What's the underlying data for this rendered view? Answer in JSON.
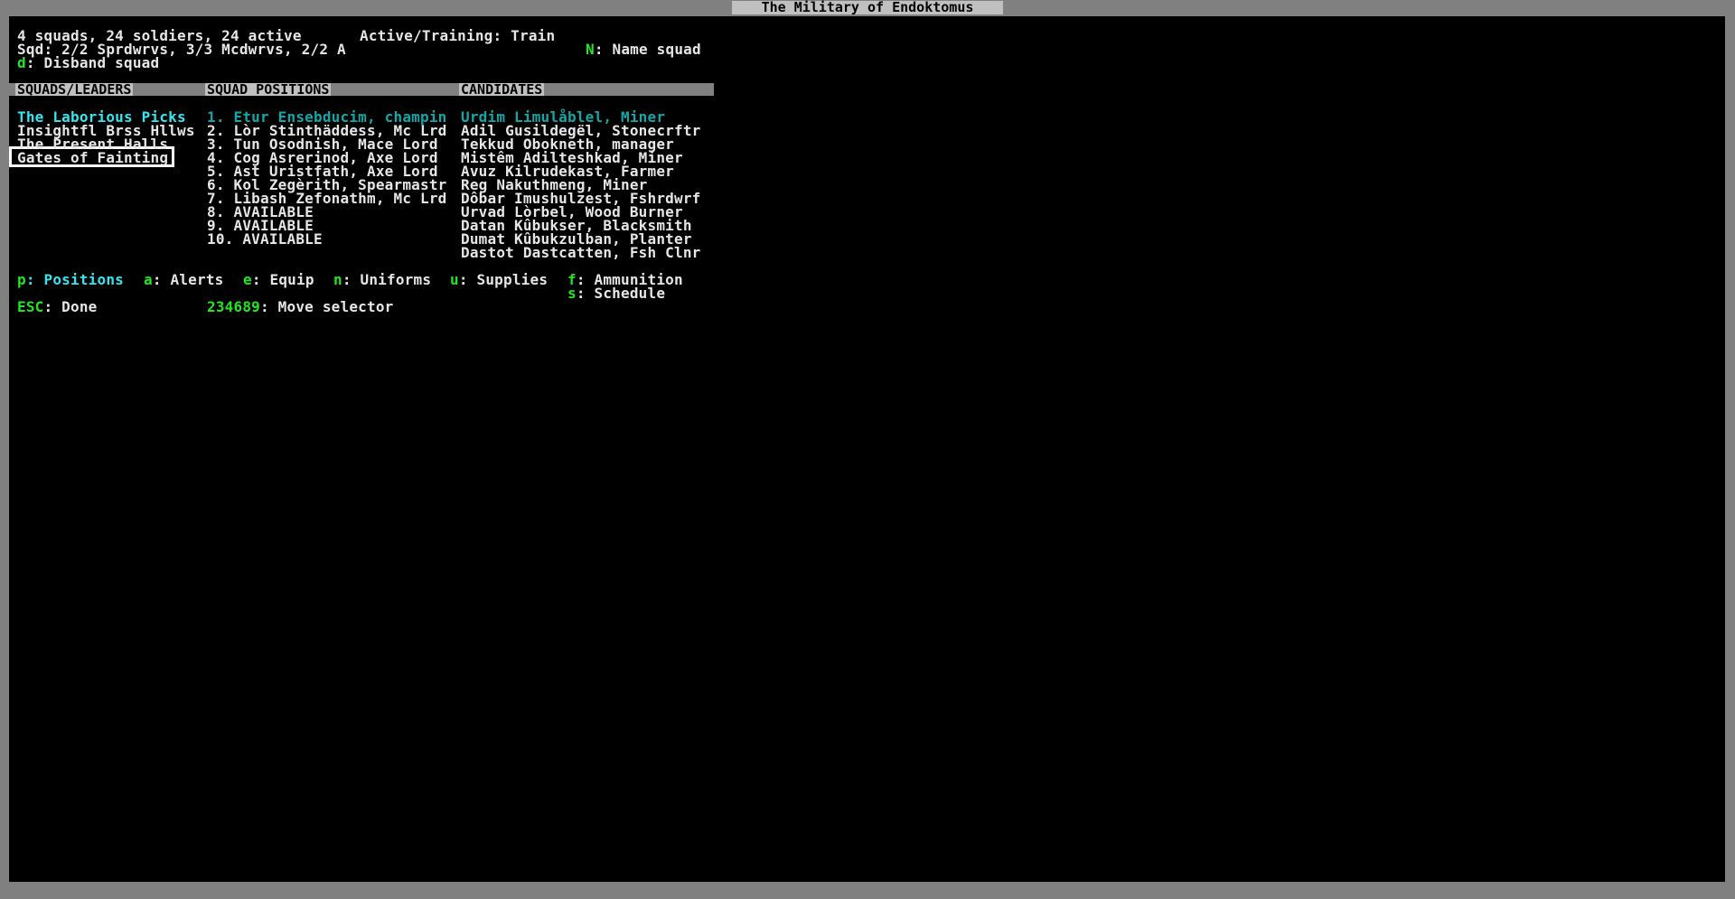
{
  "window": {
    "title": "The Military of Endoktomus"
  },
  "summary": {
    "line1": "4 squads, 24 soldiers, 24 active",
    "active_training": "Active/Training: Train",
    "line2": "Sqd: 2/2 Sprdwrvs, 3/3 Mcdwrvs, 2/2 A",
    "name_key": "N",
    "name_label": ": Name squad",
    "disband_key": "d",
    "disband_label": ": Disband squad"
  },
  "headers": {
    "squads": "SQUADS/LEADERS",
    "positions": "SQUAD POSITIONS",
    "candidates": "CANDIDATES"
  },
  "squads": [
    "The Laborious Picks",
    "Insightfl Brss Hllws",
    "The Present Halls",
    "Gates of Fainting"
  ],
  "positions": [
    "1. Etur Ensebducim, champin",
    "2. Lòr Stinthäddess, Mc Lrd",
    "3. Tun Osodnish, Mace Lord",
    "4. Cog Asrerinod, Axe Lord",
    "5. Ast Uristfath, Axe Lord",
    "6. Kol Zegèrith, Spearmastr",
    "7. Libash Zefonathm, Mc Lrd",
    "8. AVAILABLE",
    "9. AVAILABLE",
    "10. AVAILABLE"
  ],
  "candidates": [
    "Urdim Limulåblel, Miner",
    "Adil Gusildegël, Stonecrftr",
    "Tekkud Obokneth, manager",
    "Mistêm Adilteshkad, Miner",
    "Avuz Kilrudekast, Farmer",
    "Reg Nakuthmeng, Miner",
    "Dôbar Imushulzest, Fshrdwrf",
    "Urvad Lòrbel, Wood Burner",
    "Datan Kûbukser, Blacksmith",
    "Dumat Kûbukzulban, Planter",
    "Dastot Dastcatten, Fsh Clnr"
  ],
  "commands": {
    "positions_key": "p",
    "positions_label": ": Positions",
    "alerts_key": "a",
    "alerts_label": ": Alerts",
    "equip_key": "e",
    "equip_label": ": Equip",
    "uniforms_key": "n",
    "uniforms_label": ": Uniforms",
    "supplies_key": "u",
    "supplies_label": ": Supplies",
    "ammo_key": "f",
    "ammo_label": ": Ammunition",
    "schedule_key": "s",
    "schedule_label": ": Schedule",
    "done_key": "ESC",
    "done_label": ": Done",
    "move_key": "234689",
    "move_label": ": Move selector"
  },
  "colors": {
    "background": "#000000",
    "frame": "#808080",
    "hotkey": "#22e622",
    "selected": "#35e6f0",
    "text": "#e6e6e6"
  }
}
